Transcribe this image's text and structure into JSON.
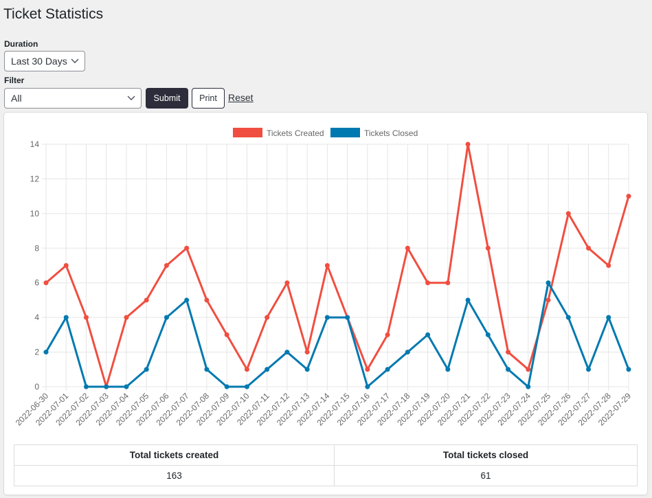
{
  "page": {
    "title": "Ticket Statistics"
  },
  "form": {
    "duration_label": "Duration",
    "duration_value": "Last 30 Days",
    "filter_label": "Filter",
    "filter_value": "All",
    "submit_label": "Submit",
    "print_label": "Print",
    "reset_label": "Reset"
  },
  "colors": {
    "created": "#f04e40",
    "closed": "#0079b0",
    "grid": "#e5e5e5",
    "tick_text": "#666666"
  },
  "chart_data": {
    "type": "line",
    "title": "",
    "xlabel": "",
    "ylabel": "",
    "ylim": [
      0,
      14
    ],
    "yticks": [
      0,
      2,
      4,
      6,
      8,
      10,
      12,
      14
    ],
    "grid": true,
    "legend_position": "top-center",
    "categories": [
      "2022-06-30",
      "2022-07-01",
      "2022-07-02",
      "2022-07-03",
      "2022-07-04",
      "2022-07-05",
      "2022-07-06",
      "2022-07-07",
      "2022-07-08",
      "2022-07-09",
      "2022-07-10",
      "2022-07-11",
      "2022-07-12",
      "2022-07-13",
      "2022-07-14",
      "2022-07-15",
      "2022-07-16",
      "2022-07-17",
      "2022-07-18",
      "2022-07-19",
      "2022-07-20",
      "2022-07-21",
      "2022-07-22",
      "2022-07-23",
      "2022-07-24",
      "2022-07-25",
      "2022-07-26",
      "2022-07-27",
      "2022-07-28",
      "2022-07-29"
    ],
    "series": [
      {
        "name": "Tickets Created",
        "color": "#f04e40",
        "values": [
          6,
          7,
          4,
          0,
          4,
          5,
          7,
          8,
          5,
          3,
          1,
          4,
          6,
          2,
          7,
          4,
          1,
          3,
          8,
          6,
          6,
          14,
          8,
          2,
          1,
          5,
          10,
          8,
          7,
          11
        ]
      },
      {
        "name": "Tickets Closed",
        "color": "#0079b0",
        "values": [
          2,
          4,
          0,
          0,
          0,
          1,
          4,
          5,
          1,
          0,
          0,
          1,
          2,
          1,
          4,
          4,
          0,
          1,
          2,
          3,
          1,
          5,
          3,
          1,
          0,
          6,
          4,
          1,
          4,
          1
        ]
      }
    ]
  },
  "summary": {
    "headers": [
      "Total tickets created",
      "Total tickets closed"
    ],
    "values": [
      "163",
      "61"
    ]
  }
}
